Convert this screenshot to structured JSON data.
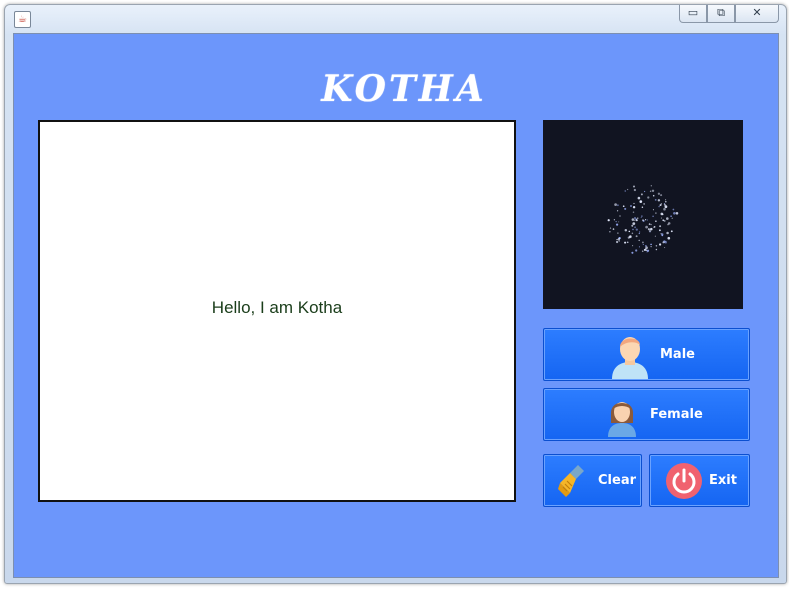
{
  "window": {
    "controls": {
      "minimize": "▭",
      "restore": "⧉",
      "close": "✕"
    },
    "app_icon": "java-icon"
  },
  "app": {
    "logo_text": "KOTHA"
  },
  "chat": {
    "message": "Hello, I am Kotha"
  },
  "buttons": {
    "male": {
      "label": "Male",
      "icon": "male-avatar-icon"
    },
    "female": {
      "label": "Female",
      "icon": "female-avatar-icon"
    },
    "clear": {
      "label": "Clear",
      "icon": "broom-icon"
    },
    "exit": {
      "label": "Exit",
      "icon": "power-icon"
    }
  },
  "colors": {
    "panel_bg": "#6c96fb",
    "button": "#1f6ff8",
    "visualizer_bg": "#111421",
    "exit_icon": "#f0626f"
  }
}
